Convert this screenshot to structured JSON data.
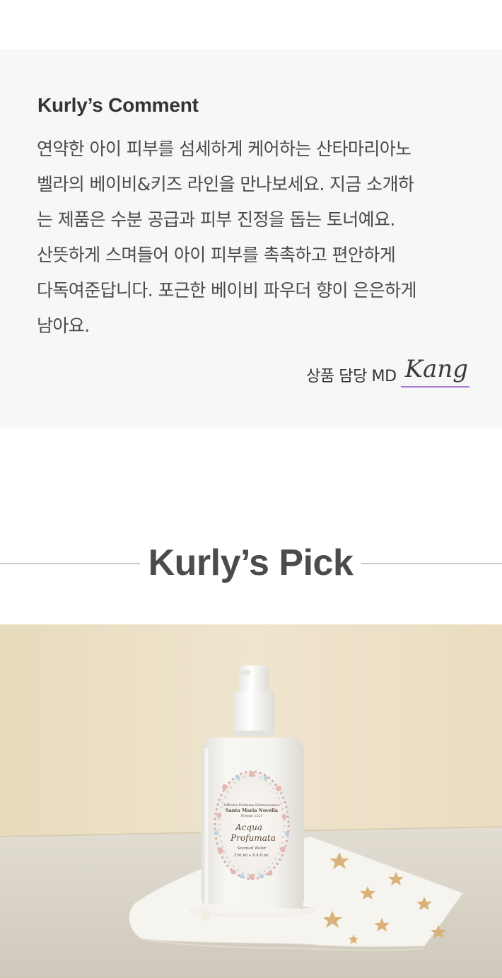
{
  "comment": {
    "title": "Kurly’s Comment",
    "body_lines": [
      "연약한 아이 피부를 섬세하게 케어하는 산타마리아노",
      "벨라의 베이비&키즈 라인을 만나보세요. 지금 소개하",
      "는 제품은 수분 공급과 피부 진정을 돕는 토너예요.",
      "산뜻하게 스며들어 아이 피부를 촉촉하고 편안하게",
      "다독여준답니다. 포근한 베이비 파우더 향이 은은하게",
      "남아요."
    ],
    "md_label": "상품 담당 MD",
    "md_signature": "Kang"
  },
  "pick": {
    "title": "Kurly’s Pick"
  },
  "product_label": {
    "brand_line1": "Officina Profumo-Farmaceutica",
    "brand_line2": "Santa Maria Novella",
    "brand_line3": "Firenze 1221",
    "name_line1": "Acqua",
    "name_line2": "Profumata",
    "subtitle": "Scented Water",
    "volume": "250 ml ℮ 8.4 fl.oz."
  },
  "colors": {
    "comment_bg": "#f7f7f7",
    "divider": "#cccccc",
    "signature_underline": "#a57ad0",
    "wall": "#ebdfc3",
    "surface": "#dcd6cc",
    "bottle": "#f4f3ef",
    "star": "#d8b27a"
  }
}
